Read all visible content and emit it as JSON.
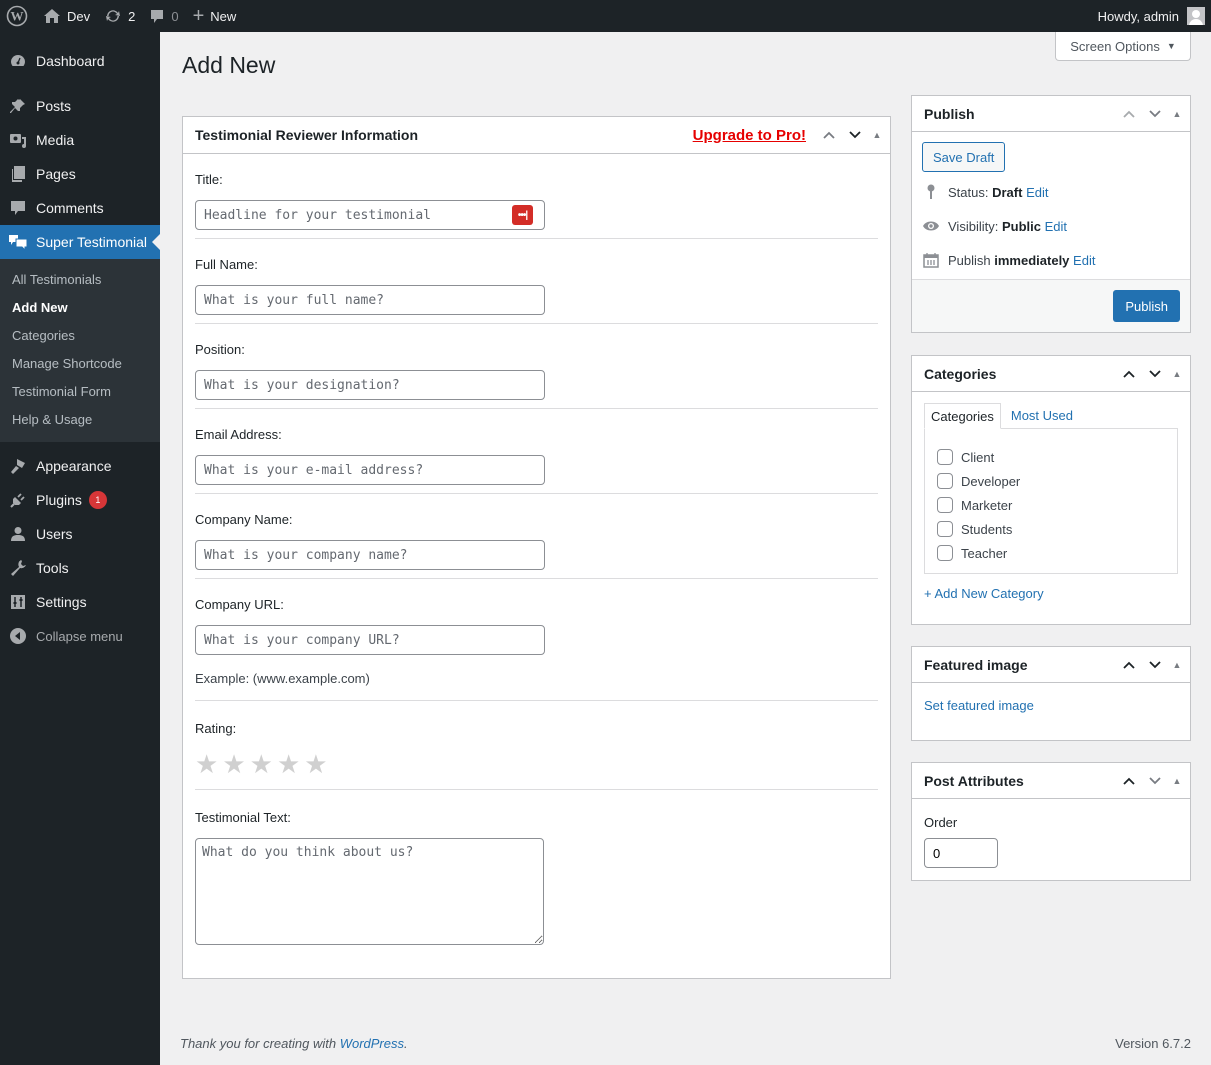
{
  "admin_bar": {
    "site_name": "Dev",
    "updates_count": "2",
    "comments_count": "0",
    "new_label": "New",
    "greeting": "Howdy, admin"
  },
  "screen_options": {
    "label": "Screen Options"
  },
  "sidebar": {
    "items": [
      {
        "label": "Dashboard",
        "icon": "dashboard-icon"
      },
      {
        "label": "Posts",
        "icon": "pin-icon"
      },
      {
        "label": "Media",
        "icon": "media-icon"
      },
      {
        "label": "Pages",
        "icon": "pages-icon"
      },
      {
        "label": "Comments",
        "icon": "comment-icon"
      },
      {
        "label": "Super Testimonial",
        "icon": "testimonial-icon"
      },
      {
        "label": "Appearance",
        "icon": "brush-icon"
      },
      {
        "label": "Plugins",
        "icon": "plugin-icon",
        "badge": "1"
      },
      {
        "label": "Users",
        "icon": "user-icon"
      },
      {
        "label": "Tools",
        "icon": "wrench-icon"
      },
      {
        "label": "Settings",
        "icon": "settings-icon"
      }
    ],
    "submenu": [
      {
        "label": "All Testimonials"
      },
      {
        "label": "Add New",
        "current": true
      },
      {
        "label": "Categories"
      },
      {
        "label": "Manage Shortcode"
      },
      {
        "label": "Testimonial Form"
      },
      {
        "label": "Help & Usage"
      }
    ],
    "collapse_label": "Collapse menu"
  },
  "page": {
    "title": "Add New"
  },
  "main_box": {
    "title": "Testimonial Reviewer Information",
    "upgrade_label": "Upgrade to Pro!",
    "fields": {
      "title": {
        "label": "Title:",
        "placeholder": "Headline for your testimonial",
        "value": ""
      },
      "full_name": {
        "label": "Full Name:",
        "placeholder": "What is your full name?",
        "value": ""
      },
      "position": {
        "label": "Position:",
        "placeholder": "What is your designation?",
        "value": ""
      },
      "email": {
        "label": "Email Address:",
        "placeholder": "What is your e-mail address?",
        "value": ""
      },
      "company_name": {
        "label": "Company Name:",
        "placeholder": "What is your company name?",
        "value": ""
      },
      "company_url": {
        "label": "Company URL:",
        "placeholder": "What is your company URL?",
        "value": "",
        "hint": "Example: (www.example.com)"
      },
      "rating": {
        "label": "Rating:",
        "value": 0,
        "max": 5,
        "star_glyph": "★"
      },
      "testimonial_text": {
        "label": "Testimonial Text:",
        "placeholder": "What do you think about us?",
        "value": ""
      }
    }
  },
  "publish_box": {
    "title": "Publish",
    "save_draft_label": "Save Draft",
    "status_label": "Status:",
    "status_value": "Draft",
    "visibility_label": "Visibility:",
    "visibility_value": "Public",
    "schedule_label": "Publish",
    "schedule_value": "immediately",
    "edit_label": "Edit",
    "publish_label": "Publish"
  },
  "categories_box": {
    "title": "Categories",
    "tabs": [
      {
        "label": "Categories"
      },
      {
        "label": "Most Used"
      }
    ],
    "items": [
      {
        "label": "Client",
        "checked": false
      },
      {
        "label": "Developer",
        "checked": false
      },
      {
        "label": "Marketer",
        "checked": false
      },
      {
        "label": "Students",
        "checked": false
      },
      {
        "label": "Teacher",
        "checked": false
      }
    ],
    "add_label": "+ Add New Category"
  },
  "featured_box": {
    "title": "Featured image",
    "link_label": "Set featured image"
  },
  "attributes_box": {
    "title": "Post Attributes",
    "order_label": "Order",
    "order_value": "0"
  },
  "footer": {
    "thanks_prefix": "Thank you for creating with ",
    "wordpress_link": "WordPress",
    "thanks_suffix": ".",
    "version": "Version 6.7.2"
  },
  "colors": {
    "accent": "#2271b1",
    "sidebar_bg": "#1d2327",
    "upgrade": "#e60000",
    "badge": "#d63638"
  }
}
